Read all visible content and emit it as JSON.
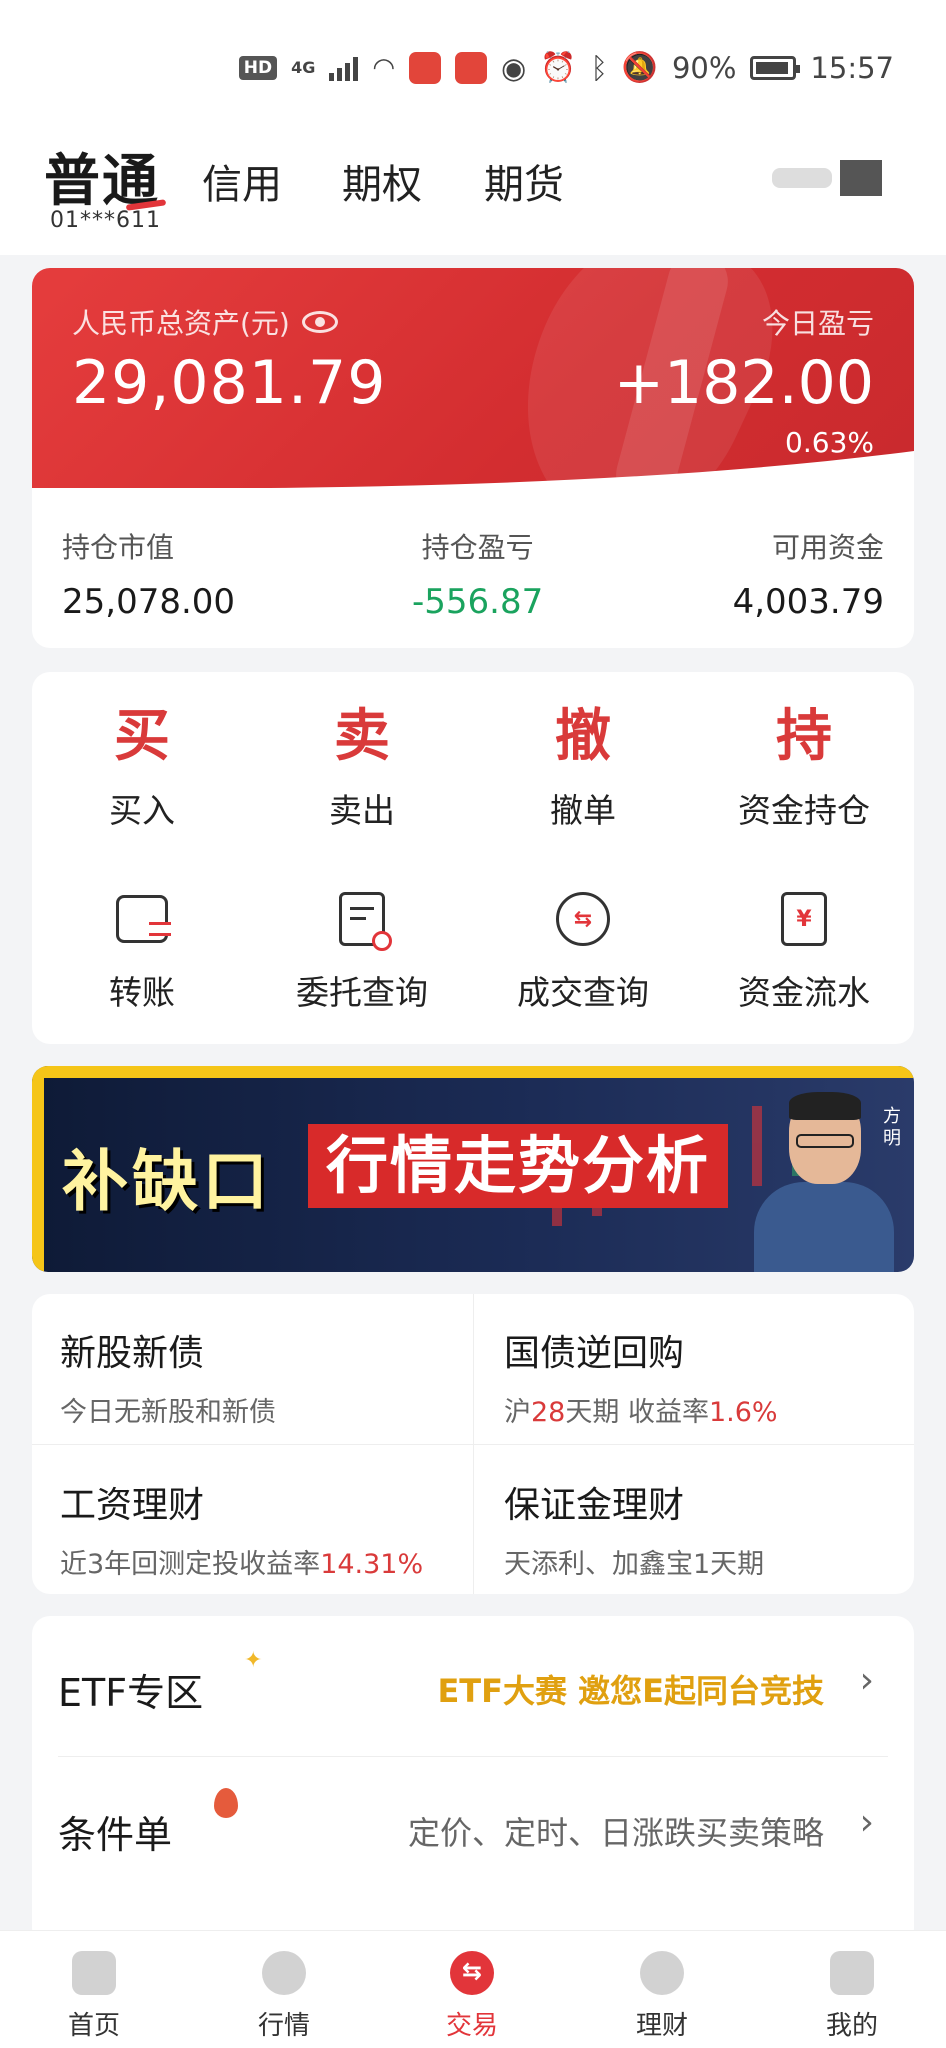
{
  "status_bar": {
    "hd": "HD",
    "network": "4G",
    "battery_pct": "90%",
    "time": "15:57"
  },
  "tabs": {
    "active": "普通",
    "items": [
      "信用",
      "期权",
      "期货"
    ],
    "account": "01***611"
  },
  "assets": {
    "total_label": "人民币总资产(元)",
    "total_value": "29,081.79",
    "pnl_label": "今日盈亏",
    "pnl_value": "+182.00",
    "pnl_pct": "0.63%",
    "market_value_label": "持仓市值",
    "market_value": "25,078.00",
    "position_pnl_label": "持仓盈亏",
    "position_pnl": "-556.87",
    "available_label": "可用资金",
    "available": "4,003.79"
  },
  "actions": {
    "row1": [
      {
        "glyph": "买",
        "label": "买入"
      },
      {
        "glyph": "卖",
        "label": "卖出"
      },
      {
        "glyph": "撤",
        "label": "撤单"
      },
      {
        "glyph": "持",
        "label": "资金持仓"
      }
    ],
    "row2": [
      {
        "icon": "transfer-icon",
        "label": "转账"
      },
      {
        "icon": "order-query-icon",
        "label": "委托查询"
      },
      {
        "icon": "deal-query-icon",
        "label": "成交查询"
      },
      {
        "icon": "fund-flow-icon",
        "label": "资金流水"
      }
    ]
  },
  "banner": {
    "part1": "补缺口",
    "part2": "行情走势分析",
    "tag": "方明"
  },
  "products": [
    {
      "title": "新股新债",
      "sub_pre": "今日无新股和新债",
      "sub_red": "",
      "sub_mid": "",
      "sub_red2": ""
    },
    {
      "title": "国债逆回购",
      "sub_pre": "沪",
      "sub_red": "28",
      "sub_mid": "天期 收益率",
      "sub_red2": "1.6%"
    },
    {
      "title": "工资理财",
      "sub_pre": "近3年回测定投收益率",
      "sub_red": "14.31%",
      "sub_mid": "",
      "sub_red2": ""
    },
    {
      "title": "保证金理财",
      "sub_pre": "天添利、加鑫宝1天期",
      "sub_red": "",
      "sub_mid": "",
      "sub_red2": ""
    }
  ],
  "list": [
    {
      "title": "ETF专区",
      "desc": "ETF大赛 邀您E起同台竞技"
    },
    {
      "title": "条件单",
      "desc": "定价、定时、日涨跌买卖策略"
    }
  ],
  "nav": [
    {
      "label": "首页",
      "icon": "home-icon"
    },
    {
      "label": "行情",
      "icon": "market-icon"
    },
    {
      "label": "交易",
      "icon": "trade-icon"
    },
    {
      "label": "理财",
      "icon": "wealth-icon"
    },
    {
      "label": "我的",
      "icon": "profile-icon"
    }
  ],
  "colors": {
    "brand_red": "#e2353a",
    "gain_green": "#1aa35e",
    "gold": "#e0a010"
  }
}
